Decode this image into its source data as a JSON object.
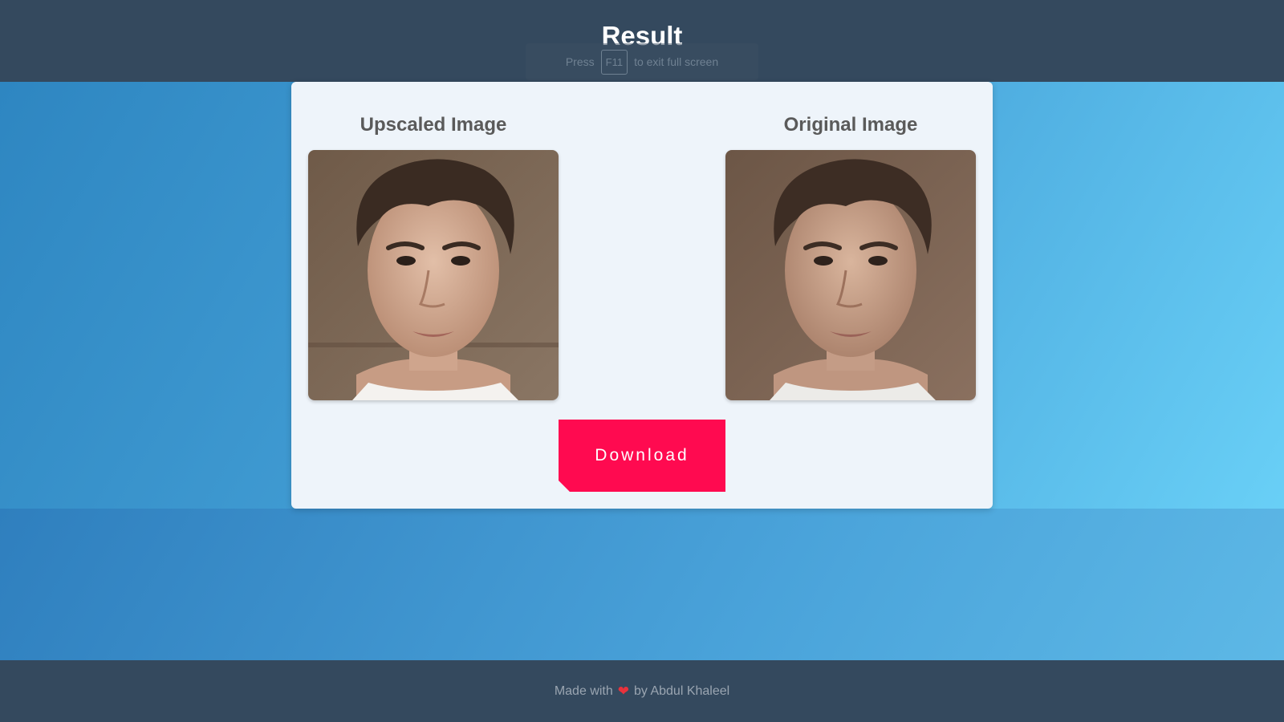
{
  "header": {
    "title": "Result",
    "fullscreen_hint": {
      "press": "Press",
      "key": "F11",
      "suffix": "to exit full screen"
    }
  },
  "card": {
    "upscaled": {
      "title": "Upscaled Image",
      "icon": "portrait-photo-icon"
    },
    "original": {
      "title": "Original Image",
      "icon": "portrait-photo-icon"
    },
    "download_label": "Download"
  },
  "footer": {
    "made_with": "Made with",
    "heart_icon": "heart-icon",
    "by": "by Abdul Khaleel"
  },
  "colors": {
    "header_bg": "#34495e",
    "card_bg": "#eef4fa",
    "download_bg": "#ff0a50",
    "download_accent": "#13d3e6",
    "heart": "#e8323c"
  }
}
